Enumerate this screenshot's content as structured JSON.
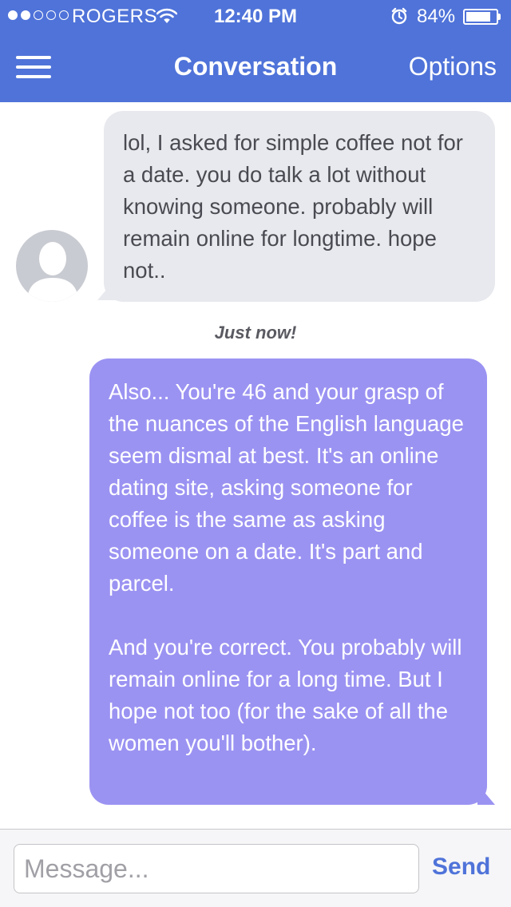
{
  "status_bar": {
    "carrier": "ROGERS",
    "time": "12:40 PM",
    "battery": "84%",
    "battery_level": 0.84,
    "signal_bars_filled": 2,
    "signal_bars_total": 5,
    "icons": [
      "signal-dots-icon",
      "wifi-icon",
      "alarm-icon",
      "battery-icon"
    ]
  },
  "nav": {
    "title": "Conversation",
    "options_label": "Options",
    "menu_icon": "hamburger-menu-icon"
  },
  "messages": [
    {
      "direction": "incoming",
      "paragraphs": [
        "lol, I asked for simple coffee not for a date. you do talk a lot without knowing someone. probably will remain online for longtime. hope not.."
      ]
    },
    {
      "direction": "outgoing",
      "timestamp": "Just now!",
      "paragraphs": [
        "Also... You're 46 and your grasp of the nuances of the English language seem dismal at best. It's an online dating site, asking someone for coffee is the same as asking someone on a date. It's part and parcel.",
        "And you're correct. You probably will remain online for a long time. But I hope not too (for the sake of all the women you'll bother)."
      ]
    }
  ],
  "composer": {
    "placeholder": "Message...",
    "value": "",
    "send_label": "Send"
  },
  "colors": {
    "header_bg": "#4f73d9",
    "incoming_bubble": "#e8e9ee",
    "outgoing_bubble": "#9b93f2",
    "send_text": "#4f73d9"
  }
}
